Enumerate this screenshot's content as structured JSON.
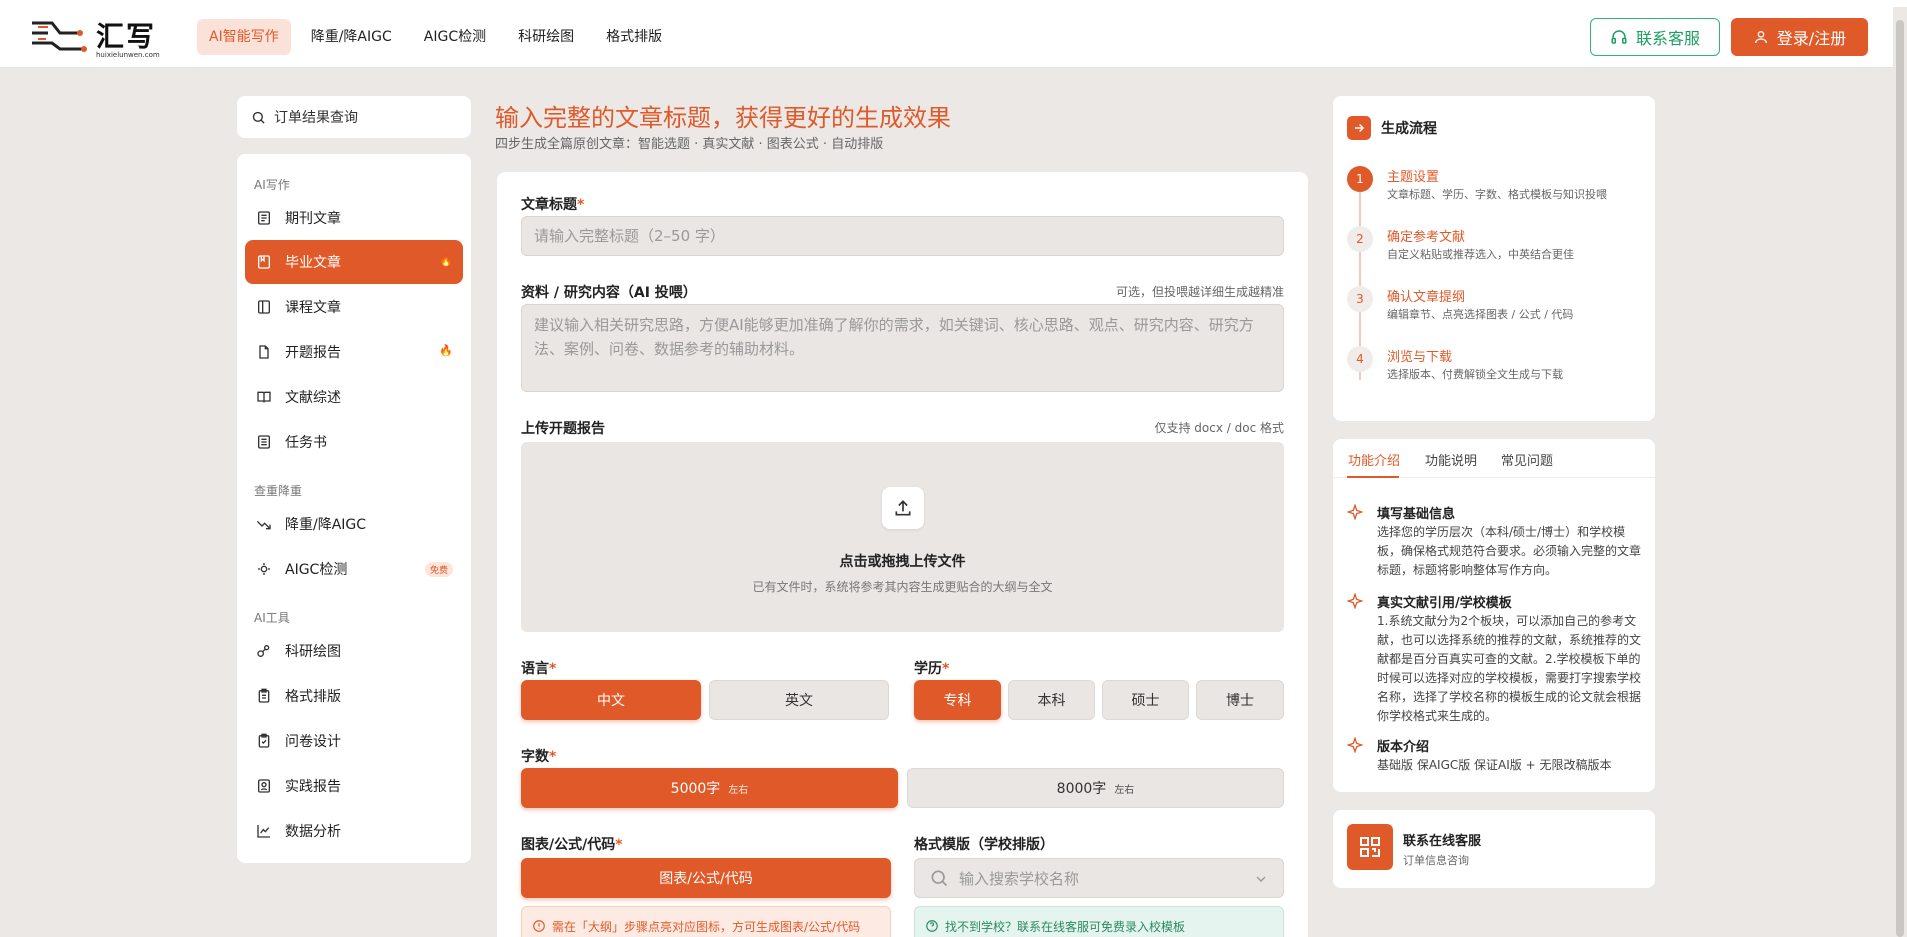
{
  "brand": {
    "name": "汇写",
    "domain": "huixielunwen.com",
    "accent": "#e05a29"
  },
  "nav": [
    {
      "label": "AI智能写作",
      "active": true
    },
    {
      "label": "降重/降AIGC"
    },
    {
      "label": "AIGC检测"
    },
    {
      "label": "科研绘图"
    },
    {
      "label": "格式排版"
    }
  ],
  "header": {
    "service_label": "联系客服",
    "login_label": "登录/注册"
  },
  "sidebar": {
    "search_label": "订单结果查询",
    "sec_ai": "AI写作",
    "sec_check": "查重降重",
    "sec_tools": "AI工具",
    "items": [
      {
        "label": "期刊文章",
        "icon": "journal-icon"
      },
      {
        "label": "毕业文章",
        "icon": "graduation-icon",
        "active": true,
        "badge": "🔥"
      },
      {
        "label": "课程文章",
        "icon": "course-icon"
      },
      {
        "label": "开题报告",
        "icon": "file-icon",
        "badge": "🔥"
      },
      {
        "label": "文献综述",
        "icon": "book-icon"
      },
      {
        "label": "任务书",
        "icon": "list-icon"
      },
      {
        "label": "降重/降AIGC",
        "icon": "trend-down-icon"
      },
      {
        "label": "AIGC检测",
        "icon": "detect-icon",
        "badge": "免费"
      },
      {
        "label": "科研绘图",
        "icon": "chart-draw-icon"
      },
      {
        "label": "格式排版",
        "icon": "format-icon"
      },
      {
        "label": "问卷设计",
        "icon": "clipboard-check-icon"
      },
      {
        "label": "实践报告",
        "icon": "report-icon"
      },
      {
        "label": "数据分析",
        "icon": "line-chart-icon"
      }
    ]
  },
  "main": {
    "headline": "输入完整的文章标题，获得更好的生成效果",
    "subline": "四步生成全篇原创文章：智能选题 · 真实文献 · 图表公式 · 自动排版",
    "title_label": "文章标题",
    "title_placeholder": "请输入完整标题（2–50 字）",
    "material_label": "资料 / 研究内容（AI 投喂）",
    "material_hint": "可选，但投喂越详细生成越精准",
    "material_placeholder": "建议输入相关研究思路，方便AI能够更加准确了解你的需求，如关键词、核心思路、观点、研究内容、研究方法、案例、问卷、数据参考的辅助材料。",
    "upload_label": "上传开题报告",
    "upload_hint": "仅支持 docx / doc 格式",
    "upload_title": "点击或拖拽上传文件",
    "upload_sub": "已有文件时，系统将参考其内容生成更贴合的大纲与全文",
    "lang_label": "语言",
    "lang_options": [
      "中文",
      "英文"
    ],
    "edu_label": "学历",
    "edu_options": [
      "专科",
      "本科",
      "硕士",
      "博士"
    ],
    "words_label": "字数",
    "words_options": [
      {
        "value": "5000字",
        "suffix": "左右"
      },
      {
        "value": "8000字",
        "suffix": "左右"
      }
    ],
    "chart_label": "图表/公式/代码",
    "chart_button": "图表/公式/代码",
    "template_label": "格式模版（学校排版）",
    "template_placeholder": "输入搜索学校名称",
    "warn_notice": "需在「大纲」步骤点亮对应图标，方可生成图表/公式/代码",
    "info_notice": "找不到学校？联系在线客服可免费录入校模板"
  },
  "flow": {
    "title": "生成流程",
    "steps": [
      {
        "num": "1",
        "title": "主题设置",
        "desc": "文章标题、学历、字数、格式模板与知识投喂"
      },
      {
        "num": "2",
        "title": "确定参考文献",
        "desc": "自定义粘贴或推荐选入，中英结合更佳"
      },
      {
        "num": "3",
        "title": "确认文章提纲",
        "desc": "编辑章节、点亮选择图表 / 公式 / 代码"
      },
      {
        "num": "4",
        "title": "浏览与下载",
        "desc": "选择版本、付费解锁全文生成与下载"
      }
    ]
  },
  "intro": {
    "tabs": [
      "功能介绍",
      "功能说明",
      "常见问题"
    ],
    "features": [
      {
        "title": "填写基础信息",
        "desc": "选择您的学历层次（本科/硕士/博士）和学校模板，确保格式规范符合要求。必须输入完整的文章标题，标题将影响整体写作方向。"
      },
      {
        "title": "真实文献引用/学校模板",
        "desc": "1.系统文献分为2个板块，可以添加自己的参考文献，也可以选择系统的推荐的文献，系统推荐的文献都是百分百真实可查的文献。2.学校模板下单的时候可以选择对应的学校模板，需要打字搜索学校名称，选择了学校名称的模板生成的论文就会根据你学校格式来生成的。"
      },
      {
        "title": "版本介绍",
        "desc": "基础版 保AIGC版 保证AI版 + 无限改稿版本"
      }
    ]
  },
  "contact": {
    "title": "联系在线客服",
    "desc": "订单信息咨询"
  }
}
